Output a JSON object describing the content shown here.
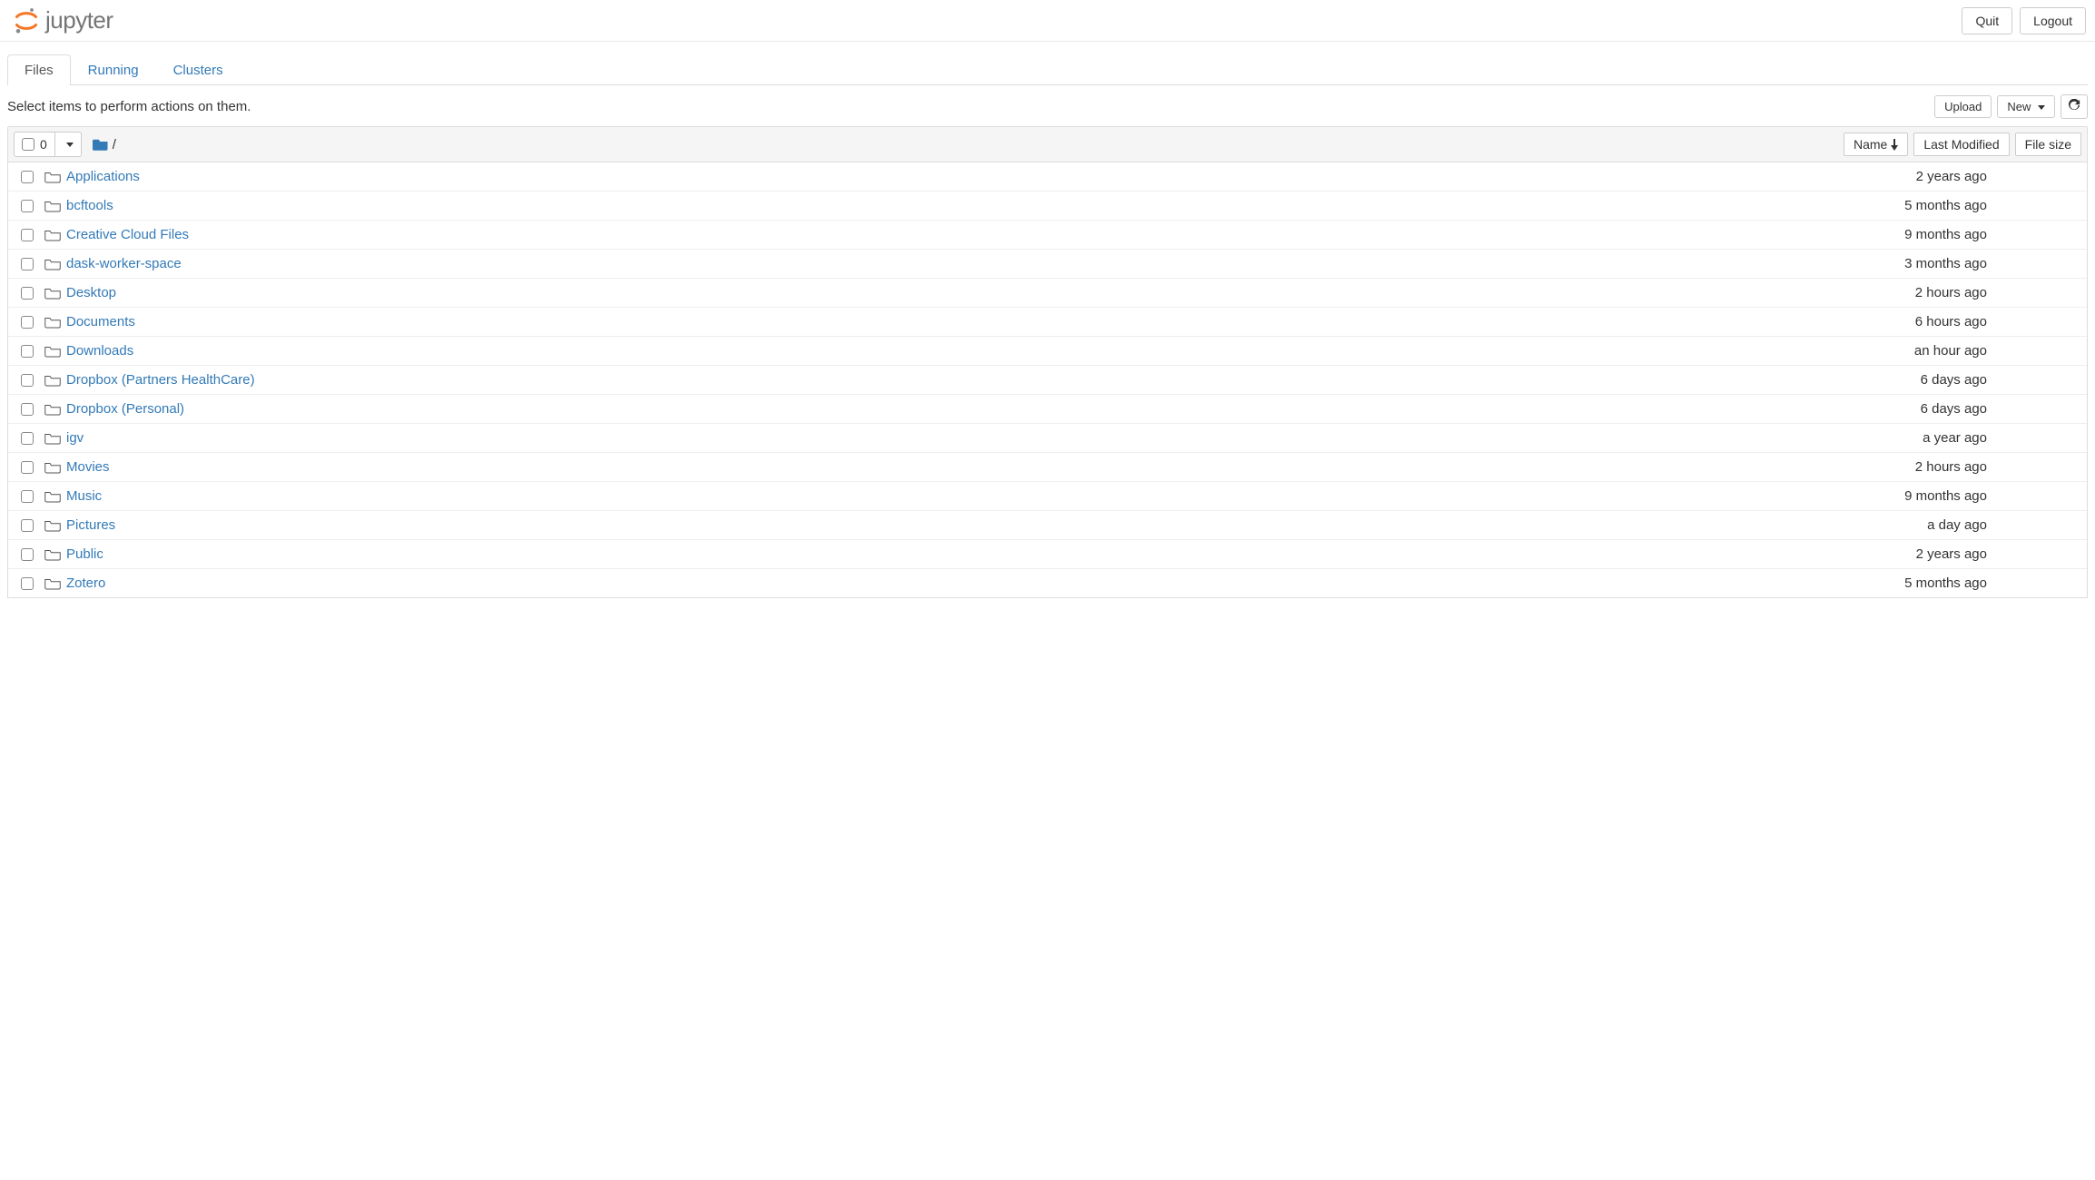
{
  "header": {
    "logo_text": "jupyter",
    "quit_label": "Quit",
    "logout_label": "Logout"
  },
  "tabs": {
    "files": "Files",
    "running": "Running",
    "clusters": "Clusters"
  },
  "toolbar": {
    "hint": "Select items to perform actions on them.",
    "upload_label": "Upload",
    "new_label": "New",
    "selected_count": "0",
    "breadcrumb_sep": "/",
    "col_name": "Name",
    "col_modified": "Last Modified",
    "col_size": "File size"
  },
  "files": [
    {
      "name": "Applications",
      "modified": "2 years ago",
      "size": ""
    },
    {
      "name": "bcftools",
      "modified": "5 months ago",
      "size": ""
    },
    {
      "name": "Creative Cloud Files",
      "modified": "9 months ago",
      "size": ""
    },
    {
      "name": "dask-worker-space",
      "modified": "3 months ago",
      "size": ""
    },
    {
      "name": "Desktop",
      "modified": "2 hours ago",
      "size": ""
    },
    {
      "name": "Documents",
      "modified": "6 hours ago",
      "size": ""
    },
    {
      "name": "Downloads",
      "modified": "an hour ago",
      "size": ""
    },
    {
      "name": "Dropbox (Partners HealthCare)",
      "modified": "6 days ago",
      "size": ""
    },
    {
      "name": "Dropbox (Personal)",
      "modified": "6 days ago",
      "size": ""
    },
    {
      "name": "igv",
      "modified": "a year ago",
      "size": ""
    },
    {
      "name": "Movies",
      "modified": "2 hours ago",
      "size": ""
    },
    {
      "name": "Music",
      "modified": "9 months ago",
      "size": ""
    },
    {
      "name": "Pictures",
      "modified": "a day ago",
      "size": ""
    },
    {
      "name": "Public",
      "modified": "2 years ago",
      "size": ""
    },
    {
      "name": "Zotero",
      "modified": "5 months ago",
      "size": ""
    }
  ]
}
